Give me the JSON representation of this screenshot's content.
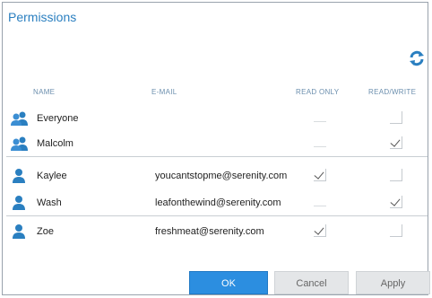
{
  "dialog": {
    "title": "Permissions",
    "refresh_icon": "refresh-icon",
    "accent_color": "#2a7fc0"
  },
  "columns": {
    "name": "NAME",
    "email": "E-MAIL",
    "read_only": "READ ONLY",
    "read_write": "READ/WRITE"
  },
  "rows": [
    {
      "name": "Everyone",
      "email": "",
      "icon": "group-icon",
      "read_only": false,
      "read_write": false,
      "read_only_enabled": false
    },
    {
      "name": "Malcolm",
      "email": "",
      "icon": "group-icon",
      "read_only": false,
      "read_write": true,
      "read_only_enabled": false
    },
    {
      "name": "Kaylee",
      "email": "youcantstopme@serenity.com",
      "icon": "user-icon",
      "read_only": true,
      "read_write": false,
      "read_only_enabled": true
    },
    {
      "name": "Wash",
      "email": "leafonthewind@serenity.com",
      "icon": "user-icon",
      "read_only": false,
      "read_write": true,
      "read_only_enabled": false
    },
    {
      "name": "Zoe",
      "email": "freshmeat@serenity.com",
      "icon": "user-icon",
      "read_only": true,
      "read_write": false,
      "read_only_enabled": true
    }
  ],
  "buttons": {
    "ok": "OK",
    "cancel": "Cancel",
    "apply": "Apply"
  }
}
